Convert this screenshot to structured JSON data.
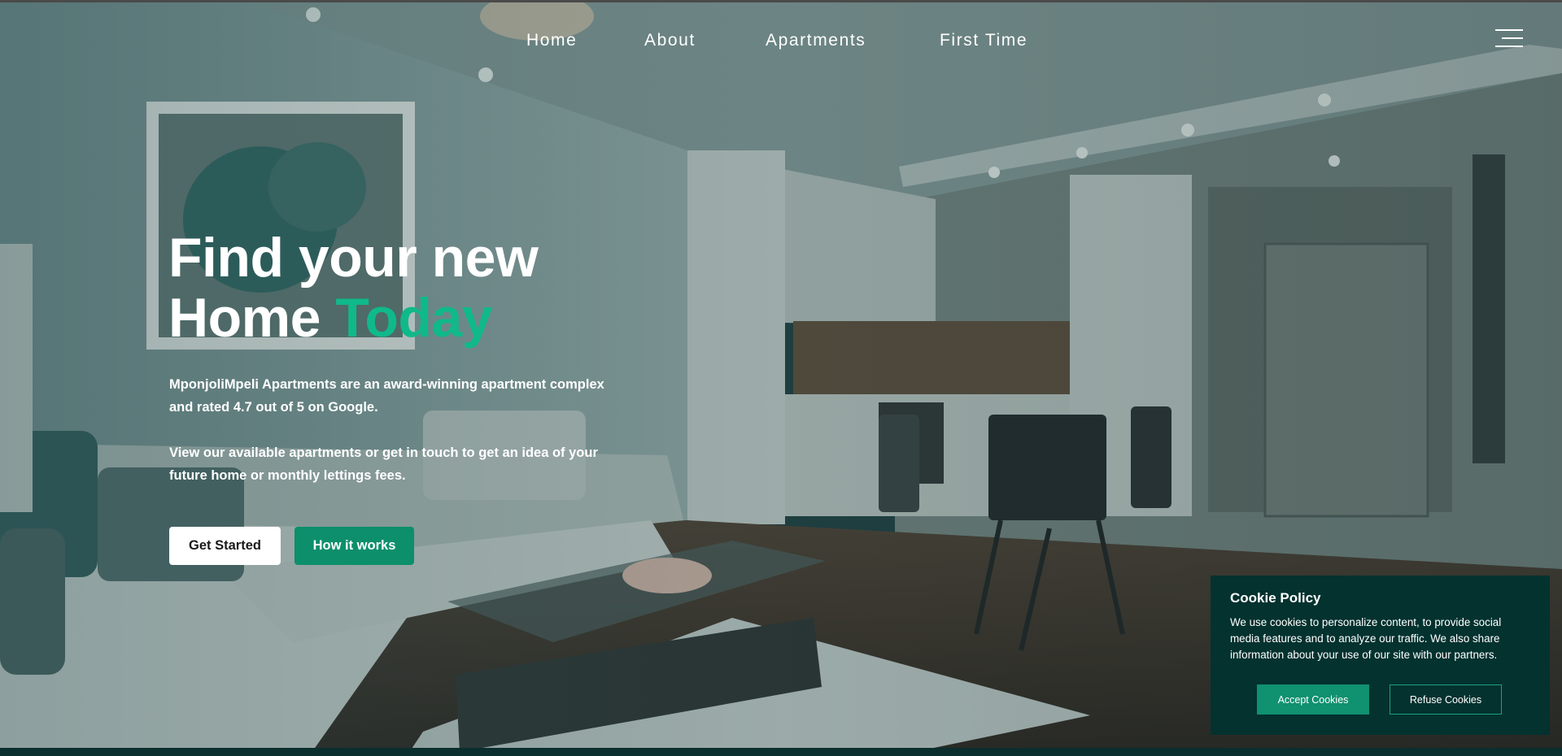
{
  "nav": {
    "items": [
      "Home",
      "About",
      "Apartments",
      "First Time"
    ]
  },
  "hero": {
    "headline_line1": "Find your new",
    "headline_line2_prefix": "Home ",
    "headline_line2_accent": "Today",
    "paragraph1": "MponjoliMpeli Apartments are an award-winning apartment complex and rated 4.7 out of 5 on Google.",
    "paragraph2": "View our available apartments or get in touch to get an idea of your future home or monthly lettings fees.",
    "primary_button": "Get Started",
    "secondary_button": "How it works"
  },
  "cookie": {
    "title": "Cookie Policy",
    "text": "We use cookies to personalize content, to provide social media features and to analyze our traffic. We also share information about your use of our site with our partners.",
    "accept_label": "Accept Cookies",
    "refuse_label": "Refuse Cookies"
  },
  "colors": {
    "accent": "#10b98a",
    "button_green": "#0d8f6c",
    "cookie_bg": "#03322f"
  },
  "icons": {
    "menu": "hamburger-menu-icon"
  }
}
